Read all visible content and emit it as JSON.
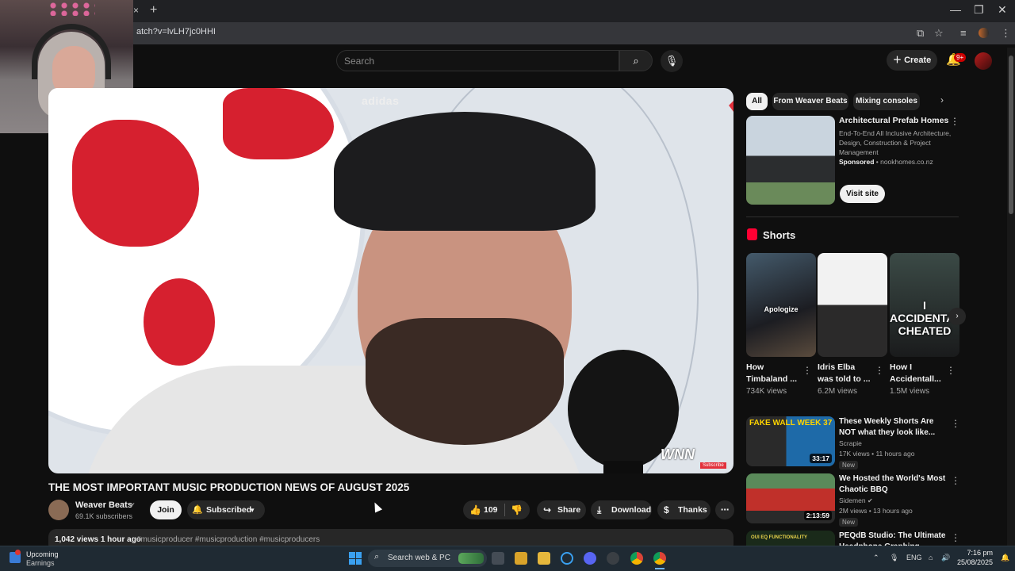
{
  "browser": {
    "url": "atch?v=lvLH7jc0HHI",
    "new_tab": "+",
    "tab_close": "×"
  },
  "header": {
    "search_placeholder": "Search",
    "create_label": "Create",
    "notifications_badge": "9+"
  },
  "video": {
    "title": "THE MOST IMPORTANT MUSIC PRODUCTION NEWS OF AUGUST 2025",
    "cap_logo": "adidas",
    "watermark": "WNN",
    "watermark_sub": "Subscribe"
  },
  "channel": {
    "name": "Weaver Beats",
    "subscribers": "69.1K subscribers",
    "join_label": "Join",
    "subscribed_label": "Subscribed"
  },
  "actions": {
    "likes": "109",
    "share": "Share",
    "download": "Download",
    "thanks": "Thanks"
  },
  "description": {
    "stats": "1,042 views  1 hour ago",
    "tags": "#musicproducer #musicproduction #musicproducers"
  },
  "chips": [
    "All",
    "From Weaver Beats",
    "Mixing consoles"
  ],
  "ad": {
    "title": "Architectural Prefab Homes",
    "desc": "End-To-End All Inclusive Architecture, Design, Construction & Project Management",
    "sponsored": "Sponsored",
    "domain": " • nookhomes.co.nz",
    "cta": "Visit site"
  },
  "shorts": {
    "heading": "Shorts",
    "items": [
      {
        "title": "How Timbaland ...",
        "views": "734K views",
        "overlay": "Apologize"
      },
      {
        "title": "Idris Elba was told to ...",
        "views": "6.2M views",
        "overlay": ""
      },
      {
        "title": "How I Accidentall...",
        "views": "1.5M views",
        "overlay": "I ACCIDENTALLY CHEATED"
      }
    ]
  },
  "recommended": [
    {
      "title": "These Weekly Shorts Are NOT what they look like...",
      "channel": "Scrapie",
      "meta": "17K views • 11 hours ago",
      "badge": "New",
      "duration": "33:17",
      "thumb_text": "FAKE WALL  WEEK 37"
    },
    {
      "title": "We Hosted the World's Most Chaotic BBQ",
      "channel": "Sidemen",
      "meta": "2M views • 13 hours ago",
      "badge": "New",
      "duration": "2:13:59",
      "thumb_text": ""
    },
    {
      "title": "PEQdB Studio: The Ultimate Headphone Graphing",
      "channel": "",
      "meta": "",
      "badge": "",
      "duration": "",
      "thumb_text": "OUI EQ FUNCTIONALITY"
    }
  ],
  "taskbar": {
    "weather_line1": "Upcoming",
    "weather_line2": "Earnings",
    "search_text": "Search web & PC",
    "lang": "ENG",
    "time": "7:16 pm",
    "date": "25/08/2025"
  },
  "colors": {
    "bg": "#0f0f0f",
    "youtube_red": "#ff0033",
    "chip_bg": "#272727"
  }
}
